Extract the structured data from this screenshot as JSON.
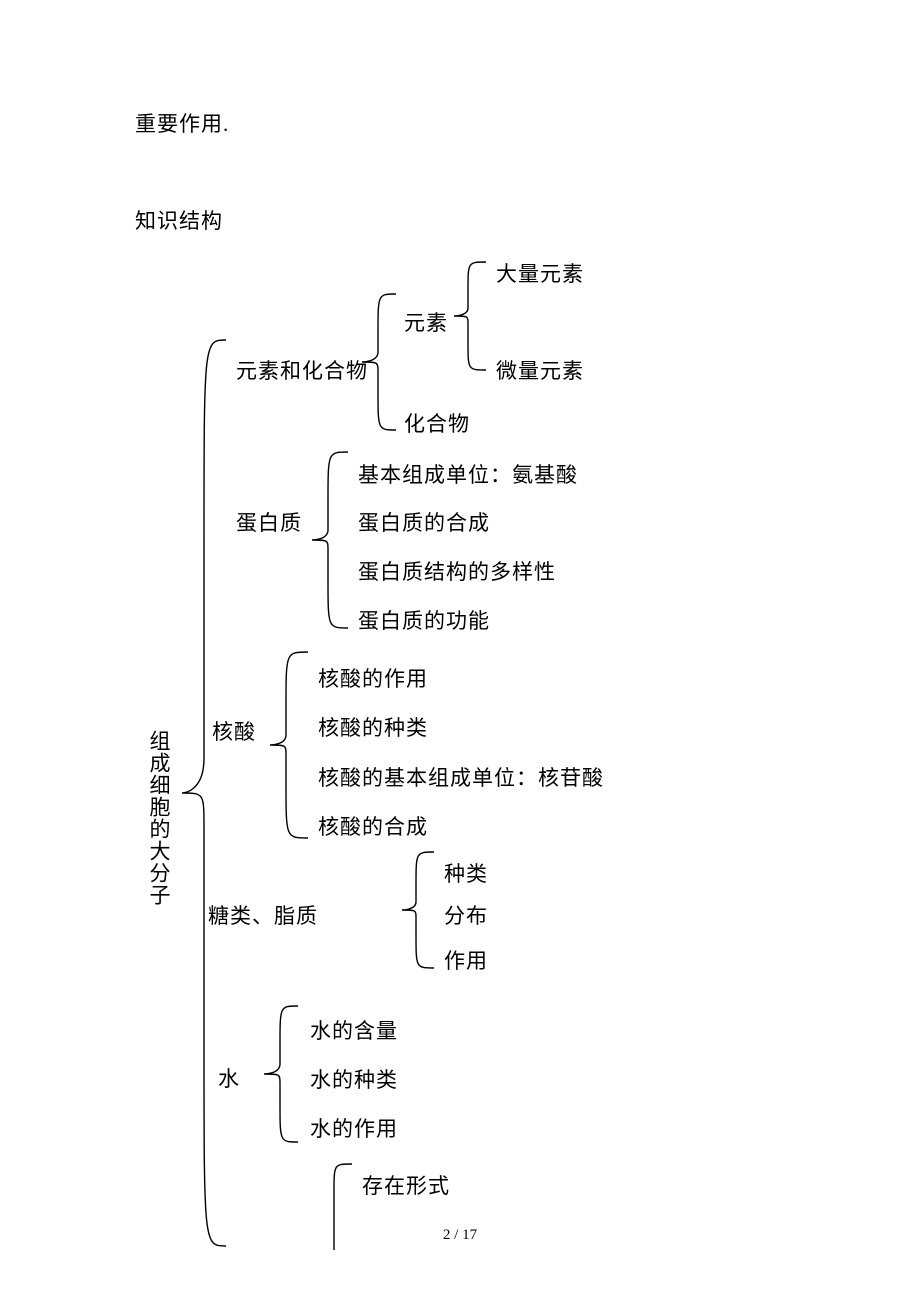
{
  "intro_tail": "重要作用.",
  "section_title": "知识结构",
  "root_label": "组成细胞的大分子",
  "nodes": {
    "elements_compounds": "元素和化合物",
    "elements": "元素",
    "macro_elements": "大量元素",
    "trace_elements": "微量元素",
    "compounds": "化合物",
    "protein": "蛋白质",
    "p1": "基本组成单位：氨基酸",
    "p2": "蛋白质的合成",
    "p3": "蛋白质结构的多样性",
    "p4": "蛋白质的功能",
    "nucleic": "核酸",
    "na1": "核酸的作用",
    "na2": "核酸的种类",
    "na3": "核酸的基本组成单位：核苷酸",
    "na4": "核酸的合成",
    "sugar_lipid": "糖类、脂质",
    "sl1": "种类",
    "sl2": "分布",
    "sl3": "作用",
    "water": "水",
    "w1": "水的含量",
    "w2": "水的种类",
    "w3": "水的作用",
    "form": "存在形式"
  },
  "footer": "2 / 17"
}
